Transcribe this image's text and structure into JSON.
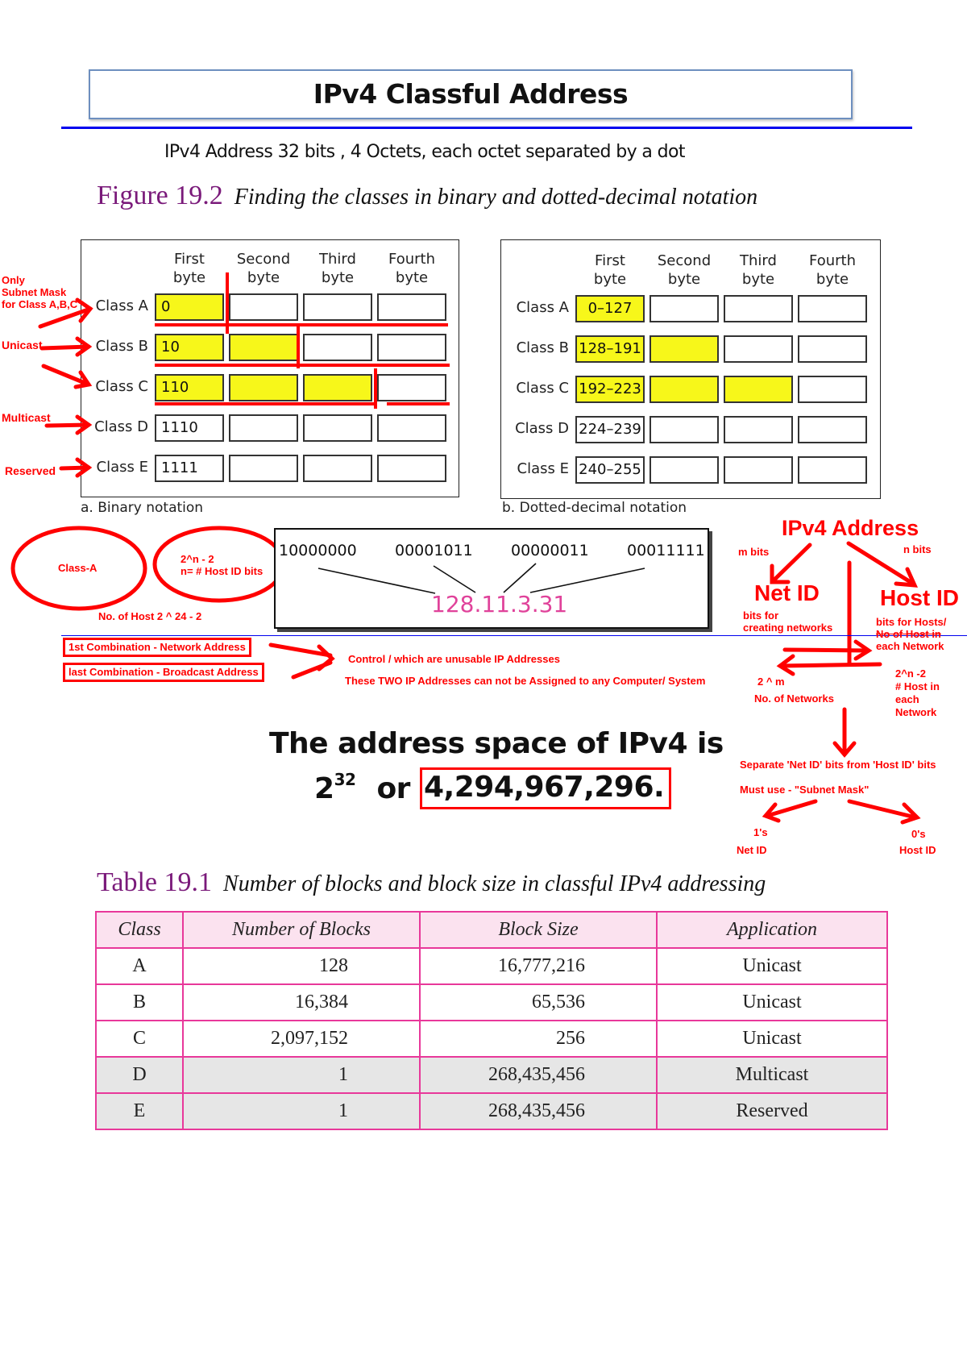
{
  "header": {
    "title": "IPv4 Classful Address",
    "subtitle": "IPv4 Address 32  bits , 4 Octets, each octet separated by a dot"
  },
  "figure": {
    "label": "Figure 19.2",
    "caption": "Finding the classes in binary and dotted-decimal notation",
    "column_headers": [
      {
        "line1": "First",
        "line2": "byte"
      },
      {
        "line1": "Second",
        "line2": "byte"
      },
      {
        "line1": "Third",
        "line2": "byte"
      },
      {
        "line1": "Fourth",
        "line2": "byte"
      }
    ],
    "binary_panel": {
      "caption": "a. Binary notation",
      "rows": [
        {
          "label": "Class A",
          "first": "0",
          "highlighted_bytes": 1
        },
        {
          "label": "Class B",
          "first": "10",
          "highlighted_bytes": 2
        },
        {
          "label": "Class C",
          "first": "110",
          "highlighted_bytes": 3
        },
        {
          "label": "Class D",
          "first": "1110",
          "highlighted_bytes": 0
        },
        {
          "label": "Class E",
          "first": "1111",
          "highlighted_bytes": 0
        }
      ]
    },
    "decimal_panel": {
      "caption": "b. Dotted-decimal notation",
      "rows": [
        {
          "label": "Class A",
          "first": "0–127",
          "highlighted_bytes": 1
        },
        {
          "label": "Class B",
          "first": "128–191",
          "highlighted_bytes": 2
        },
        {
          "label": "Class C",
          "first": "192–223",
          "highlighted_bytes": 3
        },
        {
          "label": "Class D",
          "first": "224–239",
          "highlighted_bytes": 0
        },
        {
          "label": "Class E",
          "first": "240–255",
          "highlighted_bytes": 0
        }
      ]
    }
  },
  "left_annotations": {
    "subnet_mask_note": [
      "Only",
      "Subnet Mask",
      "for Class A,B,C"
    ],
    "unicast": "Unicast",
    "multicast": "Multicast",
    "reserved": "Reserved"
  },
  "example": {
    "binary_octets": [
      "10000000",
      "00001011",
      "00000011",
      "00011111"
    ],
    "dotted_decimal": "128.11.3.31"
  },
  "host_notes": {
    "class_a_oval": "Class-A",
    "formula_line1": "2^n - 2",
    "formula_line2": "n= # Host ID bits",
    "num_hosts": "No. of Host 2 ^ 24 - 2",
    "first_combination": "1st Combination - Network Address",
    "last_combination": "last Combination - Broadcast Address",
    "control_note": "Control / which are unusable IP Addresses",
    "unassignable_note": "These TWO IP Addresses can not be Assigned to any Computer/ System"
  },
  "ipv4_diagram": {
    "title": "IPv4 Address",
    "m_bits": "m bits",
    "n_bits": "n bits",
    "net_id": "Net ID",
    "host_id": "Host ID",
    "net_desc": [
      "bits for",
      "creating networks"
    ],
    "host_desc": [
      "bits for Hosts/",
      "No of Host in",
      "each Network"
    ],
    "networks_formula": "2 ^ m",
    "networks_label": "No. of Networks",
    "hosts_formula": [
      "2^n -2",
      "# Host in",
      "each",
      "Network"
    ],
    "separate_note": "Separate 'Net ID' bits from 'Host ID' bits",
    "subnet_mask_note": "Must use - \"Subnet Mask\"",
    "ones": "1's",
    "ones_label": "Net ID",
    "zeros": "0's",
    "zeros_label": "Host ID"
  },
  "address_space": {
    "line1": "The address space of IPv4 is",
    "base": "2",
    "exponent": "32",
    "or": "or",
    "total": "4,294,967,296."
  },
  "table": {
    "label": "Table 19.1",
    "caption": "Number of blocks and block size in classful IPv4 addressing",
    "headers": [
      "Class",
      "Number of Blocks",
      "Block Size",
      "Application"
    ],
    "rows": [
      [
        "A",
        "128",
        "16,777,216",
        "Unicast"
      ],
      [
        "B",
        "16,384",
        "65,536",
        "Unicast"
      ],
      [
        "C",
        "2,097,152",
        "256",
        "Unicast"
      ],
      [
        "D",
        "1",
        "268,435,456",
        "Multicast"
      ],
      [
        "E",
        "1",
        "268,435,456",
        "Reserved"
      ]
    ]
  },
  "colors": {
    "highlight_yellow": "#f7f71a",
    "annotation_red": "#ff0000",
    "table_border_pink": "#e8389a",
    "caption_purple": "#7a1a7a",
    "dotted_decimal_pink": "#e0429a",
    "rule_blue": "#0000ee"
  }
}
